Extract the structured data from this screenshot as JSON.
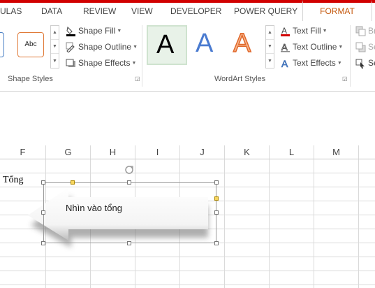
{
  "tabs": [
    "ULAS",
    "DATA",
    "REVIEW",
    "VIEW",
    "DEVELOPER",
    "POWER QUERY",
    "FORMAT"
  ],
  "active_tab": "FORMAT",
  "shape_styles": {
    "preset_label": "Abc",
    "commands": [
      "Shape Fill",
      "Shape Outline",
      "Shape Effects"
    ],
    "group_label": "Shape Styles"
  },
  "wordart_styles": {
    "samples": [
      "A",
      "A",
      "A"
    ],
    "commands": [
      "Text Fill",
      "Text Outline",
      "Text Effects"
    ],
    "group_label": "WordArt Styles"
  },
  "arrange_partial": [
    "Br",
    "Se",
    "Se"
  ],
  "columns": [
    "F",
    "G",
    "H",
    "I",
    "J",
    "K",
    "L",
    "M"
  ],
  "cell_text": "Tổng",
  "shape_text": "Nhìn vào tổng",
  "colors": {
    "tab_accent": "#d10000",
    "format_tab_text": "#c4580d",
    "handle_yellow": "#f7d55c"
  },
  "icons": [
    "shape-fill-icon",
    "shape-outline-icon",
    "shape-effects-icon",
    "text-fill-icon",
    "text-outline-icon",
    "text-effects-icon",
    "rotate-handle-icon",
    "dialog-launcher-icon"
  ]
}
